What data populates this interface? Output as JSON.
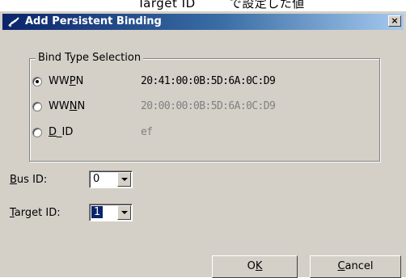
{
  "caption": {
    "text": "Target ID        で設定した値"
  },
  "window": {
    "title": "Add Persistent Binding",
    "close_symbol": "×"
  },
  "bind_type": {
    "legend": "Bind Type Selection",
    "options": [
      {
        "label": "WWPN",
        "value": "20:41:00:0B:5D:6A:0C:D9",
        "selected": true,
        "enabled": true
      },
      {
        "label": "WWNN",
        "value": "20:00:00:0B:5D:6A:0C:D9",
        "selected": false,
        "enabled": false
      },
      {
        "label": "D_ID",
        "value": "ef",
        "selected": false,
        "enabled": false
      }
    ]
  },
  "bus_id": {
    "label": "Bus ID:",
    "value": "0"
  },
  "target_id": {
    "label": "Target ID:",
    "value": "1"
  },
  "buttons": {
    "ok": "OK",
    "cancel": "Cancel"
  }
}
